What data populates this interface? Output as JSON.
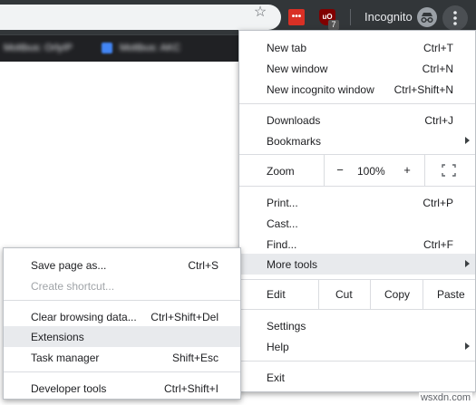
{
  "toolbar": {
    "incognito_label": "Incognito",
    "ext_red_text": "•••",
    "ext_ublock_text": "uO",
    "ext_ublock_badge": "7"
  },
  "bookmarks": {
    "items": [
      "Mottbus: OrlyIP",
      "Mottbus: AKC"
    ]
  },
  "main_menu": {
    "new_tab": {
      "label": "New tab",
      "shortcut": "Ctrl+T"
    },
    "new_window": {
      "label": "New window",
      "shortcut": "Ctrl+N"
    },
    "new_incognito": {
      "label": "New incognito window",
      "shortcut": "Ctrl+Shift+N"
    },
    "downloads": {
      "label": "Downloads",
      "shortcut": "Ctrl+J"
    },
    "bookmarks": {
      "label": "Bookmarks"
    },
    "zoom": {
      "label": "Zoom",
      "minus": "−",
      "value": "100%",
      "plus": "+"
    },
    "print": {
      "label": "Print...",
      "shortcut": "Ctrl+P"
    },
    "cast": {
      "label": "Cast..."
    },
    "find": {
      "label": "Find...",
      "shortcut": "Ctrl+F"
    },
    "more_tools": {
      "label": "More tools"
    },
    "edit": {
      "label": "Edit",
      "cut": "Cut",
      "copy": "Copy",
      "paste": "Paste"
    },
    "settings": {
      "label": "Settings"
    },
    "help": {
      "label": "Help"
    },
    "exit": {
      "label": "Exit"
    }
  },
  "sub_menu": {
    "save_page": {
      "label": "Save page as...",
      "shortcut": "Ctrl+S"
    },
    "create_shortcut": {
      "label": "Create shortcut..."
    },
    "clear_browsing": {
      "label": "Clear browsing data...",
      "shortcut": "Ctrl+Shift+Del"
    },
    "extensions": {
      "label": "Extensions"
    },
    "task_manager": {
      "label": "Task manager",
      "shortcut": "Shift+Esc"
    },
    "developer_tools": {
      "label": "Developer tools",
      "shortcut": "Ctrl+Shift+I"
    }
  },
  "watermark": "wsxdn.com"
}
